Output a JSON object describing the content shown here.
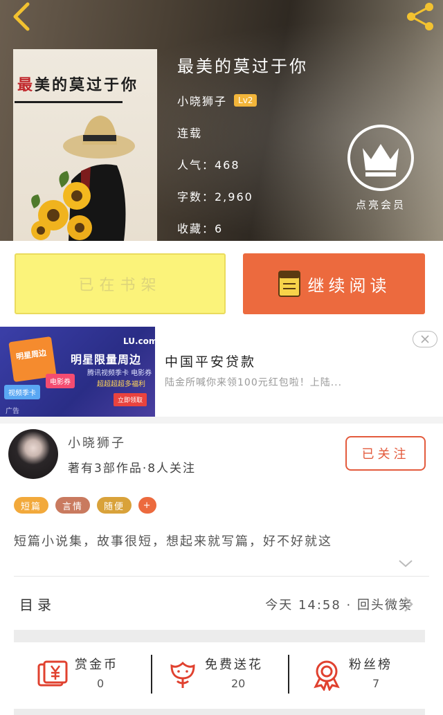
{
  "book": {
    "cover_title_first": "最",
    "cover_title_rest": "美的莫过于你",
    "title": "最美的莫过于你",
    "author": "小晓狮子",
    "level": "Lv2",
    "status": "连载",
    "popularity": "人气：468",
    "word_count": "字数：2,960",
    "favorites": "收藏：6"
  },
  "vip": {
    "label": "点亮会员"
  },
  "actions": {
    "shelf_label": "已在书架",
    "read_label": "继续阅读"
  },
  "ad": {
    "brand": "LU.com",
    "headline": "明星限量周边",
    "sub": "腾讯视频季卡 电影券",
    "sub2": "超超超超多福利",
    "cta": "立即领取",
    "gift_text": "明星周边",
    "tag1": "视频季卡",
    "tag2": "电影券",
    "ad_label": "广告",
    "title": "中国平安贷款",
    "desc": "陆金所喊你来领100元红包啦！上陆..."
  },
  "author_card": {
    "name": "小晓狮子",
    "meta": "著有3部作品·8人关注",
    "follow_label": "已关注"
  },
  "tags": [
    {
      "label": "短篇",
      "color": "#f2a93b"
    },
    {
      "label": "言情",
      "color": "#c97a5f"
    },
    {
      "label": "随便",
      "color": "#d9a23a"
    },
    {
      "label": "+",
      "color": "#ec6a3e"
    }
  ],
  "synopsis": "短篇小说集，故事很短，想起来就写篇，好不好就这",
  "catalog": {
    "title": "目录",
    "update": "今天 14:58 · 回头微笑"
  },
  "stats": [
    {
      "label": "赏金币",
      "value": "0",
      "icon": "coin-envelope-icon"
    },
    {
      "label": "免费送花",
      "value": "20",
      "icon": "flower-icon"
    },
    {
      "label": "粉丝榜",
      "value": "7",
      "icon": "medal-icon"
    }
  ],
  "colors": {
    "accent": "#ec6a3e",
    "shelf_bg": "#fbf37a",
    "follow": "#e35a3c"
  }
}
